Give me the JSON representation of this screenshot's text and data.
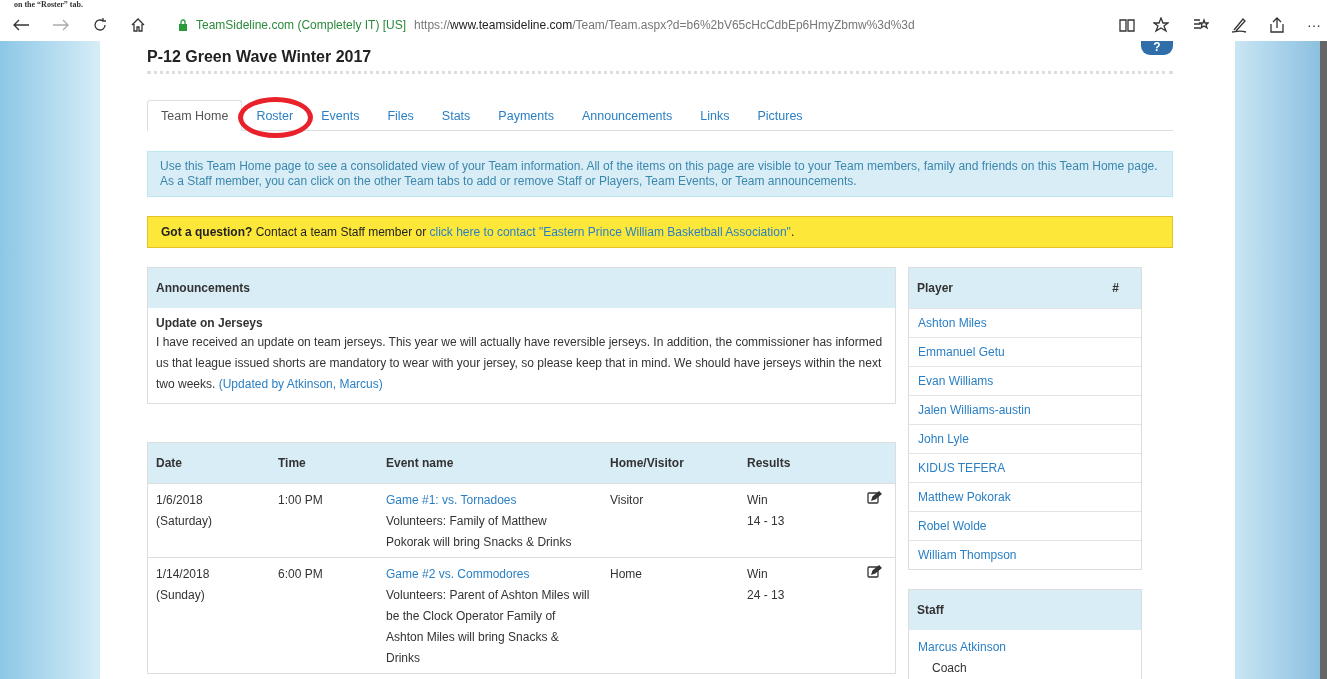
{
  "caption": "on the “Roster” tab.",
  "browser": {
    "site_identity": "TeamSideline.com (Completely IT) [US]",
    "url_prefix": "https://",
    "url_host": "www.teamsideline.com",
    "url_path": "/Team/Team.aspx?d=b6%2bV65cHcCdbEp6HmyZbmw%3d%3d",
    "more": "···"
  },
  "help": {
    "label": "?"
  },
  "team_title": "P-12 Green Wave Winter 2017",
  "tabs": [
    {
      "label": "Team Home",
      "selected": true,
      "circled": false
    },
    {
      "label": "Roster",
      "selected": false,
      "circled": true
    },
    {
      "label": "Events",
      "selected": false,
      "circled": false
    },
    {
      "label": "Files",
      "selected": false,
      "circled": false
    },
    {
      "label": "Stats",
      "selected": false,
      "circled": false
    },
    {
      "label": "Payments",
      "selected": false,
      "circled": false
    },
    {
      "label": "Announcements",
      "selected": false,
      "circled": false
    },
    {
      "label": "Links",
      "selected": false,
      "circled": false
    },
    {
      "label": "Pictures",
      "selected": false,
      "circled": false
    }
  ],
  "info": "Use this Team Home page to see a consolidated view of your Team information. All of the items on this page are visible to your Team members, family and friends on this Team Home page. As a Staff member, you can click on the other Team tabs to add or remove Staff or Players, Team Events, or Team announcements.",
  "question": {
    "text": "**Got a question?** Contact a team Staff member or ",
    "link": "click here to contact \"Eastern Prince William Basketball Association\"",
    "end": "."
  },
  "announcements": {
    "title": "Announcements",
    "items": [
      {
        "heading": "Update on Jerseys",
        "body": "I have received an update on team jerseys. This year we will actually have reversible jerseys. In addition, the commissioner has informed us that league issued shorts are mandatory to wear with your jersey, so please keep that in mind. We should have jerseys within the next two weeks.",
        "updated_by": "(Updated by Atkinson, Marcus)"
      }
    ]
  },
  "events": {
    "columns": [
      "Date",
      "Time",
      "Event name",
      "Home/Visitor",
      "Results"
    ],
    "rows": [
      {
        "date": "1/6/2018",
        "day": "(Saturday)",
        "time": "1:00 PM",
        "event": "Game #1: vs. Tornadoes",
        "volunteers": "Volunteers: Family of Matthew Pokorak will bring Snacks & Drinks",
        "home_visitor": "Visitor",
        "result": "Win",
        "score": "14 - 13"
      },
      {
        "date": "1/14/2018",
        "day": "(Sunday)",
        "time": "6:00 PM",
        "event": "Game #2 vs. Commodores",
        "volunteers": "Volunteers: Parent of Ashton Miles will be the Clock Operator Family of Ashton Miles will bring Snacks & Drinks",
        "home_visitor": "Home",
        "result": "Win",
        "score": "24 - 13"
      }
    ]
  },
  "players": {
    "columns": [
      "Player",
      "#"
    ],
    "rows": [
      "Ashton Miles",
      "Emmanuel Getu",
      "Evan Williams",
      "Jalen Williams-austin",
      "John Lyle",
      "KIDUS TEFERA",
      "Matthew Pokorak",
      "Robel Wolde",
      "William Thompson"
    ]
  },
  "staff": {
    "title": "Staff",
    "members": [
      {
        "name": "Marcus Atkinson",
        "role": "Coach"
      }
    ]
  }
}
